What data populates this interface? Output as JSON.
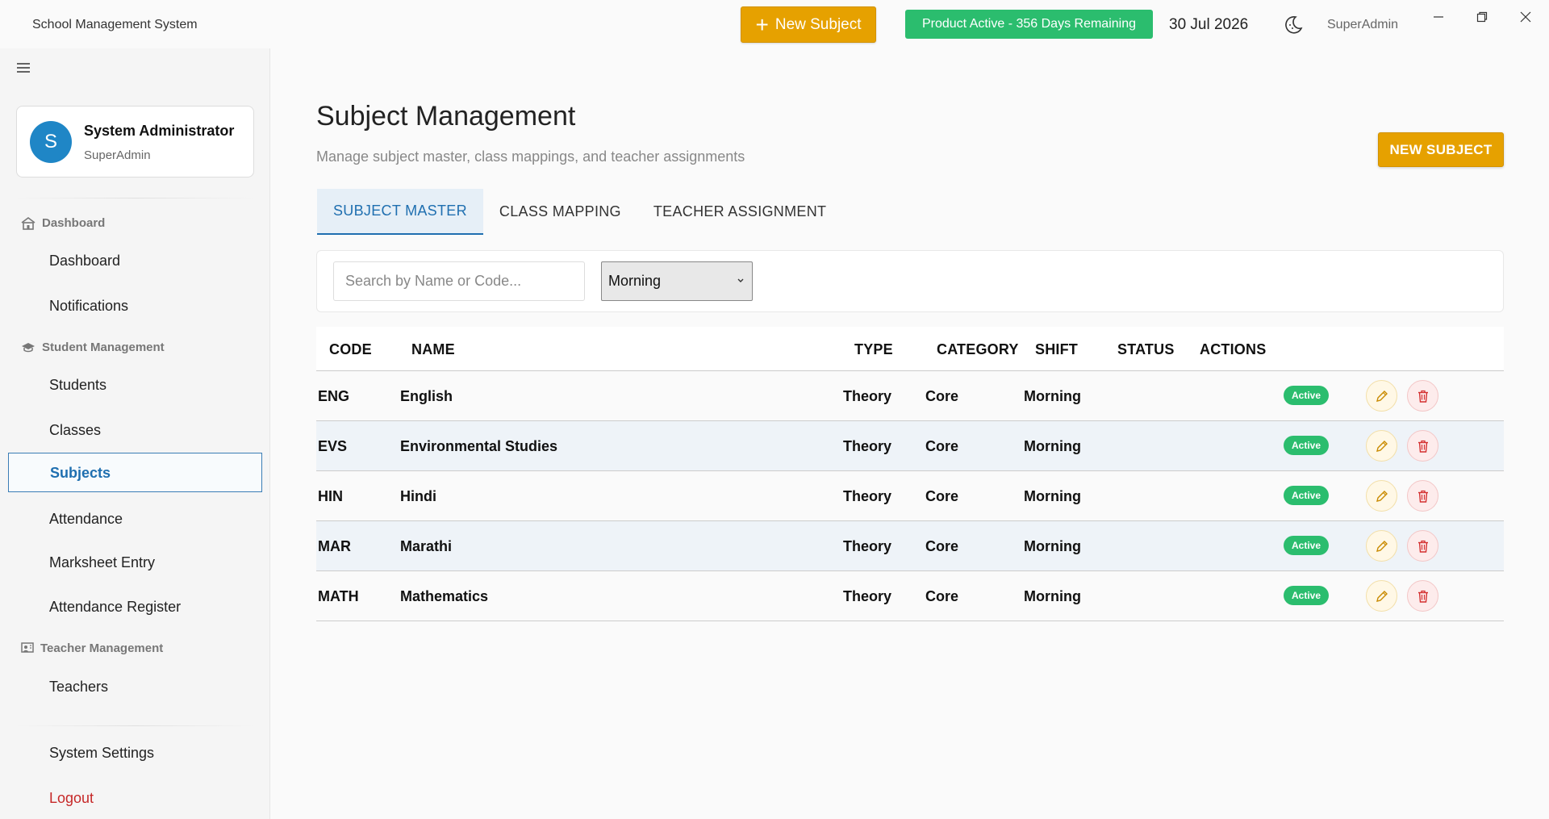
{
  "window": {
    "app_title": "School Management System",
    "new_subject_label": "New Subject",
    "license_text": "Product Active - 356 Days Remaining",
    "date": "30 Jul 2026",
    "user": "SuperAdmin",
    "theme_icon": "moon-icon"
  },
  "sidebar": {
    "profile": {
      "initial": "S",
      "name": "System Administrator",
      "role": "SuperAdmin"
    },
    "sections": [
      {
        "label": "Dashboard",
        "icon": "school-icon",
        "items": [
          "Dashboard",
          "Notifications"
        ]
      },
      {
        "label": "Student Management",
        "icon": "graduation-cap-icon",
        "items": [
          "Students",
          "Classes",
          "Subjects",
          "Attendance",
          "Marksheet Entry",
          "Attendance Register"
        ]
      },
      {
        "label": "Teacher Management",
        "icon": "teacher-icon",
        "items": [
          "Teachers"
        ]
      }
    ],
    "active_item": "Subjects",
    "settings_label": "System Settings",
    "logout_label": "Logout"
  },
  "main": {
    "title": "Subject Management",
    "subtitle": "Manage subject master, class mappings, and teacher assignments",
    "new_button": "NEW SUBJECT",
    "tabs": [
      {
        "label": "SUBJECT MASTER",
        "active": true
      },
      {
        "label": "CLASS MAPPING",
        "active": false
      },
      {
        "label": "TEACHER ASSIGNMENT",
        "active": false
      }
    ],
    "filters": {
      "search_placeholder": "Search by Name or Code...",
      "search_value": "",
      "shift_selected": "Morning"
    },
    "table": {
      "columns": [
        "CODE",
        "NAME",
        "TYPE",
        "CATEGORY",
        "SHIFT",
        "STATUS",
        "ACTIONS"
      ],
      "rows": [
        {
          "code": "ENG",
          "name": "English",
          "type": "Theory",
          "category": "Core",
          "shift": "Morning",
          "status": "Active"
        },
        {
          "code": "EVS",
          "name": "Environmental Studies",
          "type": "Theory",
          "category": "Core",
          "shift": "Morning",
          "status": "Active"
        },
        {
          "code": "HIN",
          "name": "Hindi",
          "type": "Theory",
          "category": "Core",
          "shift": "Morning",
          "status": "Active"
        },
        {
          "code": "MAR",
          "name": "Marathi",
          "type": "Theory",
          "category": "Core",
          "shift": "Morning",
          "status": "Active"
        },
        {
          "code": "MATH",
          "name": "Mathematics",
          "type": "Theory",
          "category": "Core",
          "shift": "Morning",
          "status": "Active"
        }
      ]
    }
  },
  "colors": {
    "accent_orange": "#e6a100",
    "status_green": "#2bbd6e",
    "active_blue": "#1f6fb0",
    "logout_red": "#c62828"
  }
}
